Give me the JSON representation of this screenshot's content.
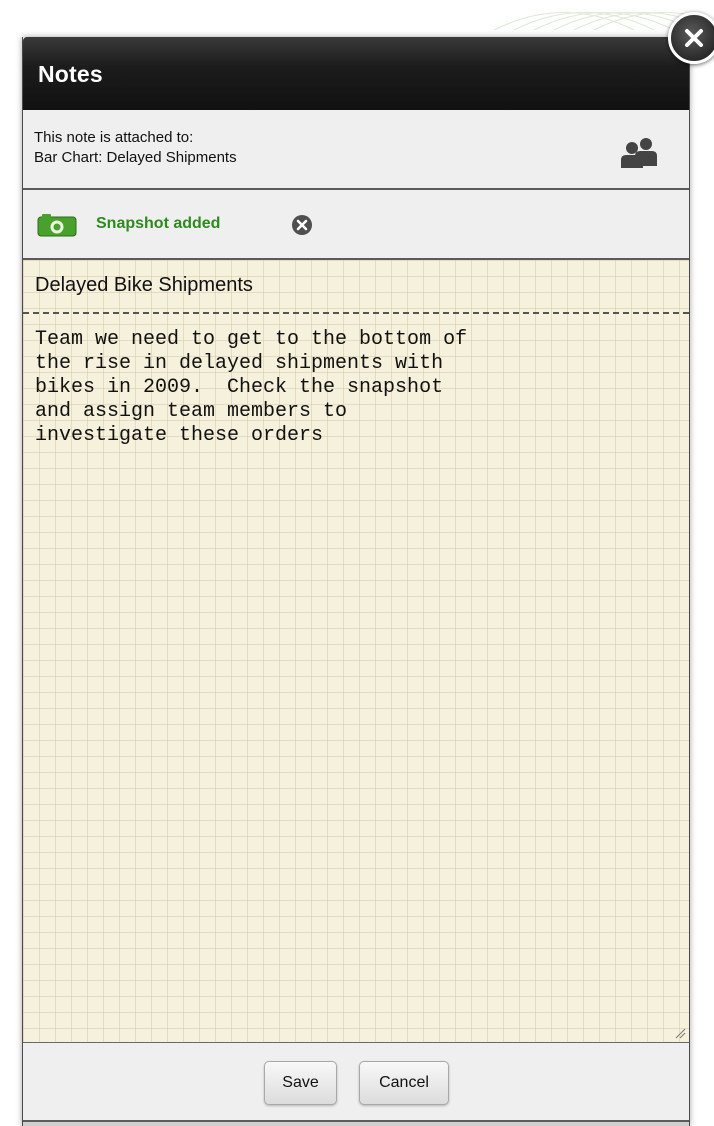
{
  "dialog": {
    "title": "Notes",
    "close_icon": "close-icon"
  },
  "attachment": {
    "line1": "This note is attached to:",
    "line2": "Bar Chart: Delayed Shipments",
    "share_icon": "people-icon"
  },
  "snapshot": {
    "icon": "camera-icon",
    "label": "Snapshot added",
    "remove_icon": "remove-circle-icon",
    "label_color": "#2f8a1e"
  },
  "note": {
    "title": "Delayed Bike Shipments",
    "body": "Team we need to get to the bottom of\nthe rise in delayed shipments with\nbikes in 2009.  Check the snapshot\nand assign team members to\ninvestigate these orders",
    "paper_color": "#f6f1dc"
  },
  "buttons": {
    "save_label": "Save",
    "cancel_label": "Cancel"
  }
}
